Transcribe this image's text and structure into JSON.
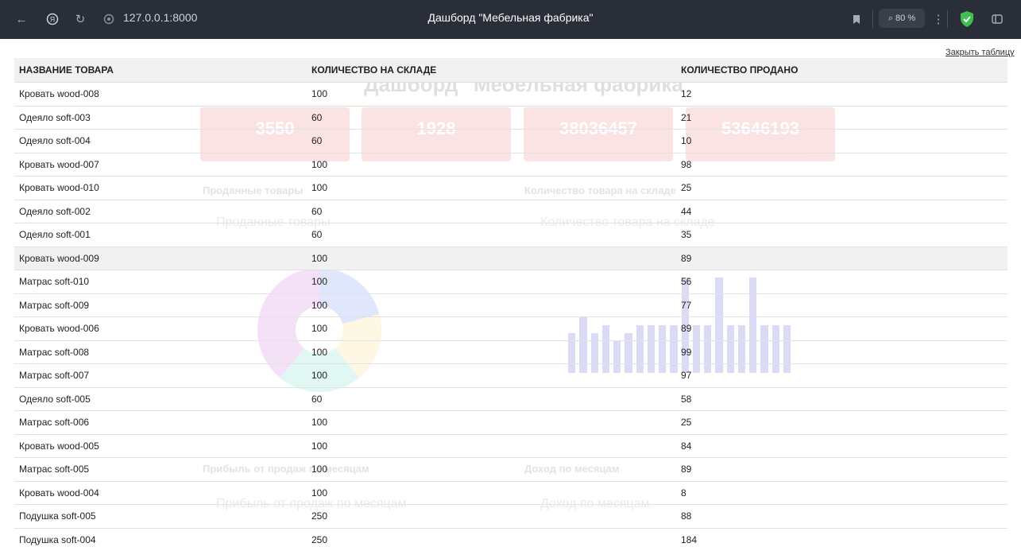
{
  "browser": {
    "url": "127.0.0.1:8000",
    "title": "Дашборд \"Мебельная фабрика\"",
    "zoom": "80 %"
  },
  "dashboard_bg": {
    "title": "Дашборд \"Мебельная фабрика\"",
    "cards": [
      "3550",
      "1928",
      "38036457",
      "53646193"
    ],
    "sections": {
      "sold": "Проданные товары",
      "stock": "Количество товара на складе",
      "profit": "Прибыль от продаж по месяцам",
      "income": "Доход по месяцам"
    }
  },
  "table": {
    "close_label": "Закрыть таблицу",
    "headers": [
      "НАЗВАНИЕ ТОВАРА",
      "КОЛИЧЕСТВО НА СКЛАДЕ",
      "КОЛИЧЕСТВО ПРОДАНО"
    ],
    "rows": [
      [
        "Кровать wood-008",
        "100",
        "12"
      ],
      [
        "Одеяло soft-003",
        "60",
        "21"
      ],
      [
        "Одеяло soft-004",
        "60",
        "10"
      ],
      [
        "Кровать wood-007",
        "100",
        "98"
      ],
      [
        "Кровать wood-010",
        "100",
        "25"
      ],
      [
        "Одеяло soft-002",
        "60",
        "44"
      ],
      [
        "Одеяло soft-001",
        "60",
        "35"
      ],
      [
        "Кровать wood-009",
        "100",
        "89"
      ],
      [
        "Матрас soft-010",
        "100",
        "56"
      ],
      [
        "Матрас soft-009",
        "100",
        "77"
      ],
      [
        "Кровать wood-006",
        "100",
        "89"
      ],
      [
        "Матрас soft-008",
        "100",
        "99"
      ],
      [
        "Матрас soft-007",
        "100",
        "97"
      ],
      [
        "Одеяло soft-005",
        "60",
        "58"
      ],
      [
        "Матрас soft-006",
        "100",
        "25"
      ],
      [
        "Кровать wood-005",
        "100",
        "84"
      ],
      [
        "Матрас soft-005",
        "100",
        "89"
      ],
      [
        "Кровать wood-004",
        "100",
        "8"
      ],
      [
        "Подушка soft-005",
        "250",
        "88"
      ],
      [
        "Подушка soft-004",
        "250",
        "184"
      ]
    ]
  }
}
